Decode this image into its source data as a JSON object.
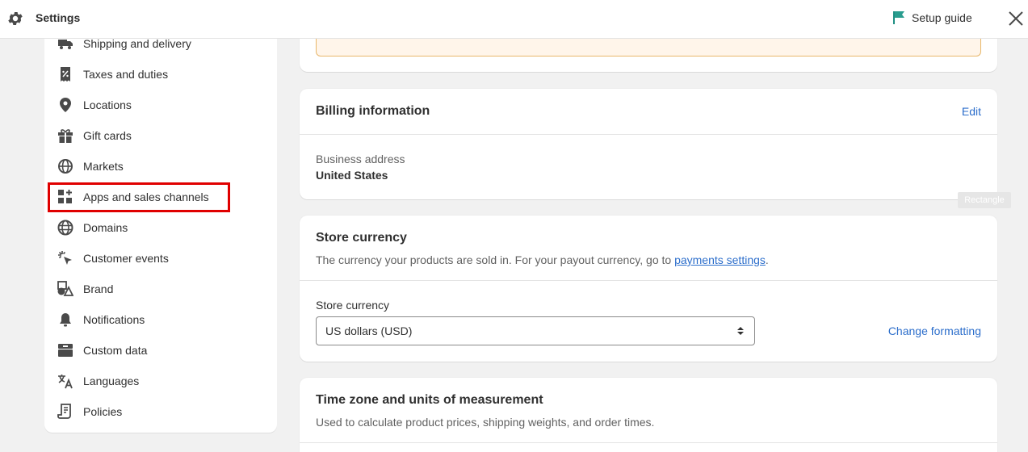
{
  "header": {
    "title": "Settings",
    "setup_guide": "Setup guide",
    "accent_flag_color": "#2a9d8f"
  },
  "sidebar": {
    "items": [
      {
        "label": "Shipping and delivery",
        "icon": "truck-icon"
      },
      {
        "label": "Taxes and duties",
        "icon": "receipt-percent-icon"
      },
      {
        "label": "Locations",
        "icon": "location-pin-icon"
      },
      {
        "label": "Gift cards",
        "icon": "gift-icon"
      },
      {
        "label": "Markets",
        "icon": "globe-markets-icon"
      },
      {
        "label": "Apps and sales channels",
        "icon": "apps-plus-icon"
      },
      {
        "label": "Domains",
        "icon": "globe-icon"
      },
      {
        "label": "Customer events",
        "icon": "cursor-click-icon"
      },
      {
        "label": "Brand",
        "icon": "brand-shapes-icon"
      },
      {
        "label": "Notifications",
        "icon": "bell-icon"
      },
      {
        "label": "Custom data",
        "icon": "database-icon"
      },
      {
        "label": "Languages",
        "icon": "translate-icon"
      },
      {
        "label": "Policies",
        "icon": "document-icon"
      }
    ],
    "highlighted_item": "Apps and sales channels",
    "highlight_color": "#e00000"
  },
  "billing": {
    "title": "Billing information",
    "edit_label": "Edit",
    "address_label": "Business address",
    "address_value": "United States"
  },
  "tooltip": {
    "text": "Rectangle"
  },
  "currency": {
    "title": "Store currency",
    "description_prefix": "The currency your products are sold in. For your payout currency, go to ",
    "description_link": "payments settings",
    "description_suffix": ".",
    "select_label": "Store currency",
    "select_value": "US dollars (USD)",
    "change_formatting": "Change formatting"
  },
  "timezone": {
    "title": "Time zone and units of measurement",
    "description": "Used to calculate product prices, shipping weights, and order times."
  }
}
